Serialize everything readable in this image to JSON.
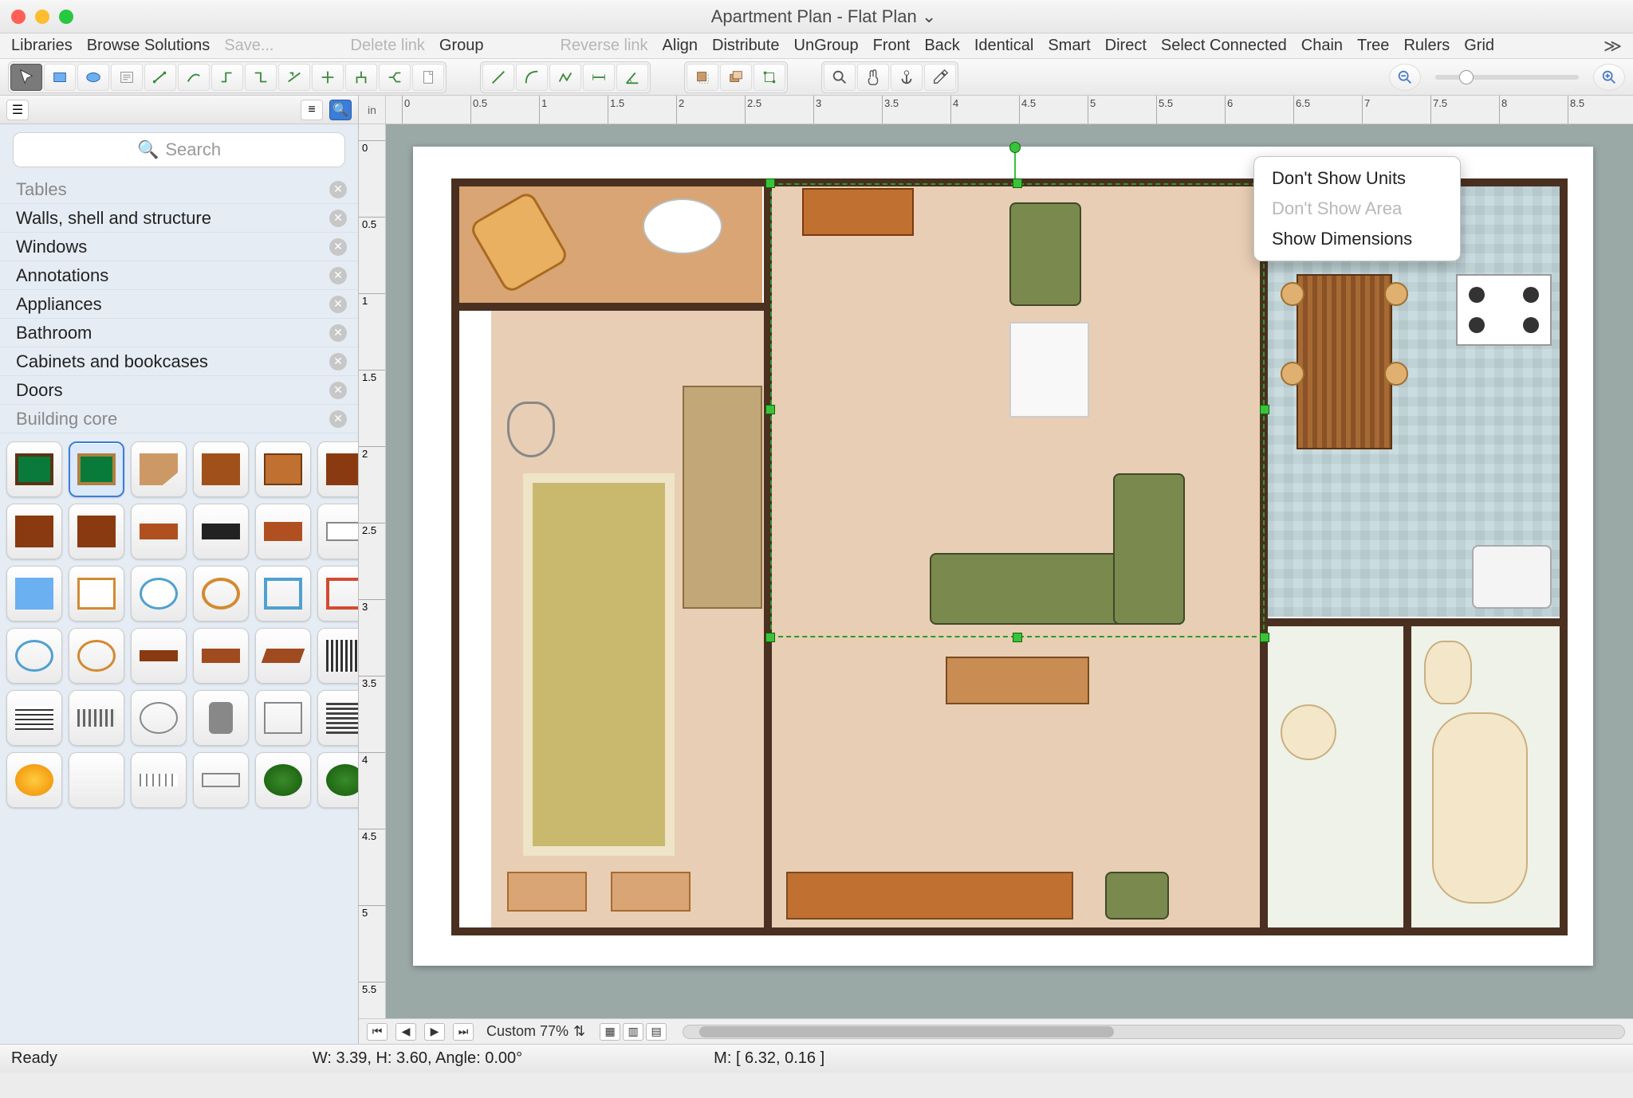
{
  "window": {
    "title": "Apartment Plan - Flat Plan ⌄"
  },
  "menubar": {
    "items": [
      "Libraries",
      "Browse Solutions",
      "Save...",
      "Delete link",
      "Group",
      "Reverse link",
      "Align",
      "Distribute",
      "UnGroup",
      "Front",
      "Back",
      "Identical",
      "Smart",
      "Direct",
      "Select Connected",
      "Chain",
      "Tree",
      "Rulers",
      "Grid"
    ],
    "disabled": [
      "Save...",
      "Delete link",
      "Reverse link"
    ],
    "overflow": "≫"
  },
  "toolbar": {
    "groups": [
      [
        "pointer",
        "rect",
        "ellipse",
        "text",
        "connector-direct",
        "connector-curve",
        "connector-step",
        "connector-l",
        "connector-z",
        "connector-t",
        "connector-multi",
        "connector-tree",
        "page"
      ],
      [
        "line",
        "arc",
        "polyline",
        "dim-h",
        "dim-angle"
      ],
      [
        "shadow",
        "layers",
        "smart-dim"
      ],
      [
        "zoom",
        "pan",
        "anchor",
        "eyedrop"
      ]
    ],
    "zoom": {
      "out": "−",
      "in": "+"
    }
  },
  "sidebar": {
    "search_placeholder": "Search",
    "categories_top": "Tables",
    "categories": [
      "Walls, shell and structure",
      "Windows",
      "Annotations",
      "Appliances",
      "Bathroom",
      "Cabinets and bookcases",
      "Doors",
      "Building core"
    ],
    "shape_names": [
      "pool-table",
      "door",
      "corner-cabinet",
      "cabinet-1",
      "bookcase",
      "cabinet-brown-1",
      "cabinet-brown-2",
      "cabinet-brown-3",
      "shelf-1",
      "shelf-2",
      "cabinet-low",
      "cabinet-panel",
      "glass-panel",
      "mirror-rect",
      "mirror-oval",
      "rug-oval",
      "frame-1",
      "frame-2",
      "frame-3",
      "circle-blue",
      "circle-orange",
      "strip",
      "brick",
      "brick-angle",
      "grate",
      "lines-vert",
      "radiator",
      "fan",
      "lamp",
      "mirror-stand",
      "vent",
      "light-round",
      "blank",
      "panel-lines",
      "panel-2",
      "bush-1",
      "bush-2"
    ]
  },
  "ruler": {
    "unit": "in",
    "h_labels": [
      "0",
      "0.5",
      "1",
      "1.5",
      "2",
      "2.5",
      "3",
      "3.5",
      "4",
      "4.5",
      "5",
      "5.5",
      "6",
      "6.5",
      "7",
      "7.5",
      "8",
      "8.5"
    ],
    "v_labels": [
      "0",
      "0.5",
      "1",
      "1.5",
      "2",
      "2.5",
      "3",
      "3.5",
      "4",
      "4.5",
      "5",
      "5.5"
    ]
  },
  "context_menu": {
    "items": [
      {
        "label": "Don't Show Units",
        "disabled": false
      },
      {
        "label": "Don't Show Area",
        "disabled": true
      },
      {
        "label": "Show Dimensions",
        "disabled": false
      }
    ]
  },
  "bottombar": {
    "zoom_label": "Custom 77%"
  },
  "status": {
    "ready": "Ready",
    "dims": "W: 3.39,  H: 3.60,  Angle: 0.00°",
    "mouse": "M: [ 6.32, 0.16 ]"
  }
}
